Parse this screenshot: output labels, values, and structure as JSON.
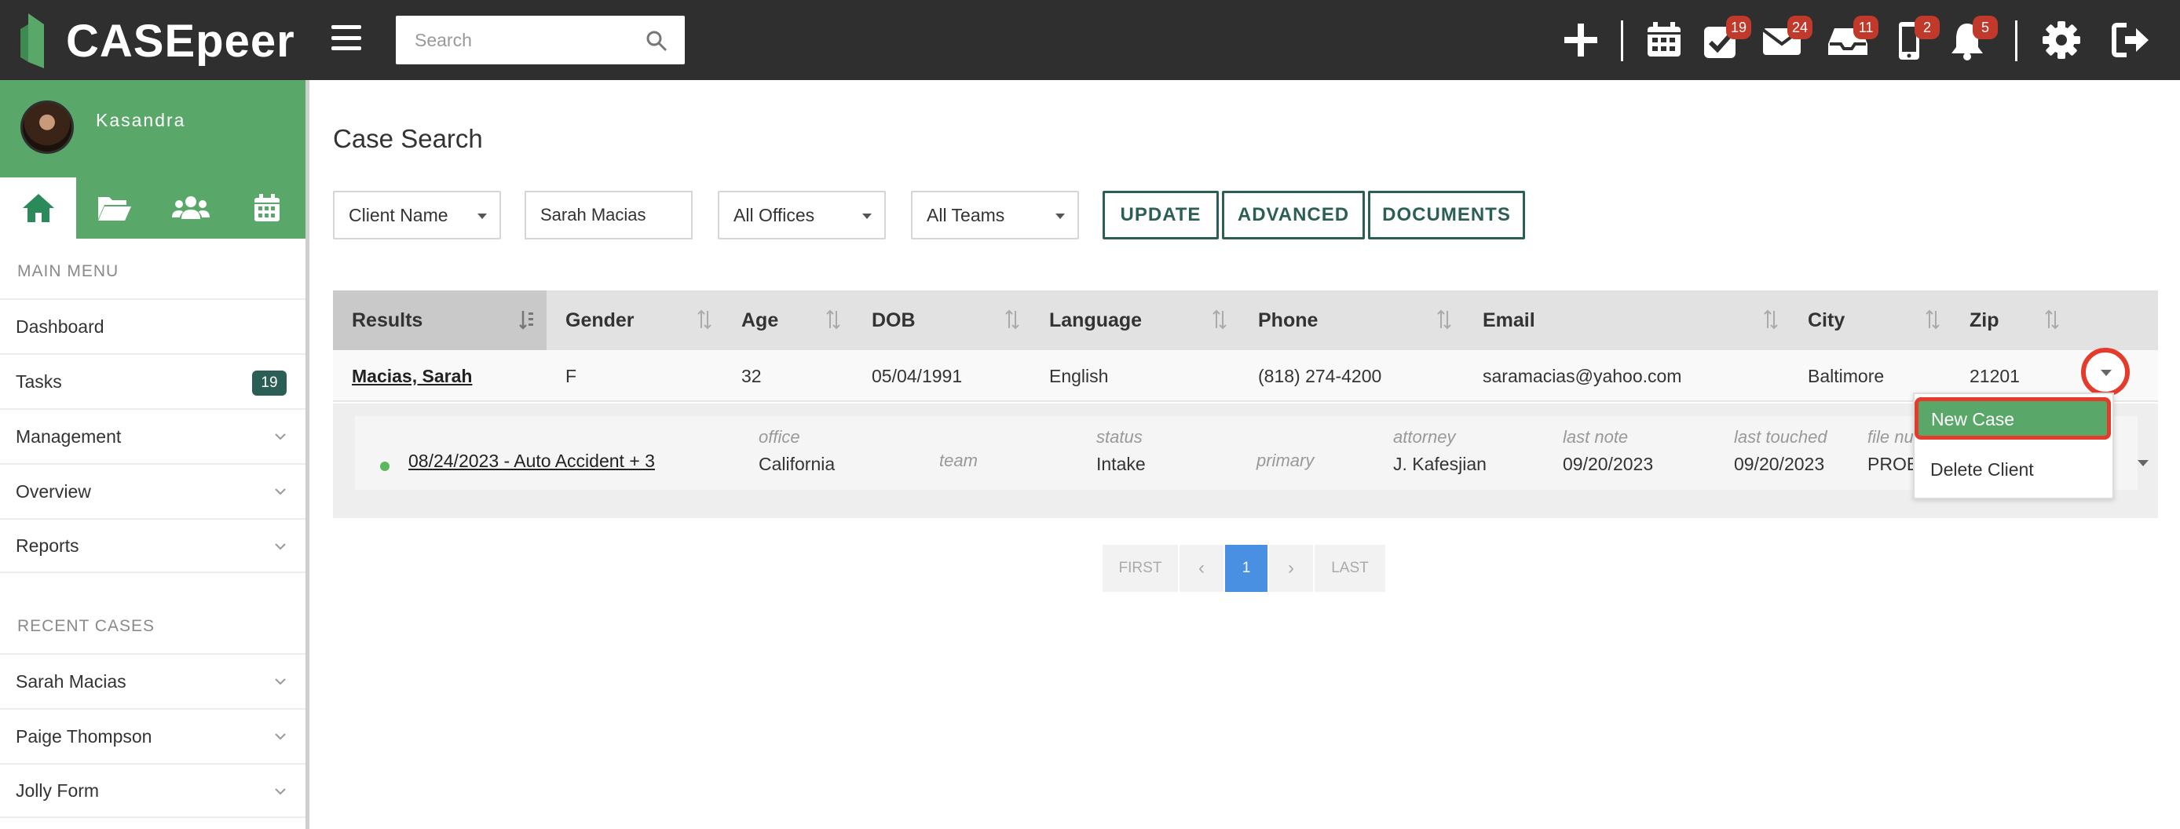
{
  "app": {
    "brand": "CASEpeer",
    "search_placeholder": "Search"
  },
  "topbar": {
    "badges": {
      "tasks": "19",
      "mail": "24",
      "inbox": "11",
      "phone": "2",
      "notifications": "5"
    }
  },
  "sidebar": {
    "user_name": "Kasandra",
    "main_menu_label": "MAIN MENU",
    "items": [
      {
        "label": "Dashboard"
      },
      {
        "label": "Tasks",
        "count": "19"
      },
      {
        "label": "Management"
      },
      {
        "label": "Overview"
      },
      {
        "label": "Reports"
      }
    ],
    "recent_label": "RECENT CASES",
    "recent": [
      {
        "label": "Sarah Macias"
      },
      {
        "label": "Paige Thompson"
      },
      {
        "label": "Jolly Form"
      }
    ]
  },
  "page": {
    "title": "Case Search"
  },
  "filters": {
    "field_select": "Client Name",
    "query_value": "Sarah Macias",
    "office_select": "All Offices",
    "team_select": "All Teams",
    "update_label": "UPDATE",
    "advanced_label": "ADVANCED",
    "documents_label": "DOCUMENTS"
  },
  "table": {
    "headers": [
      "Results",
      "Gender",
      "Age",
      "DOB",
      "Language",
      "Phone",
      "Email",
      "City",
      "Zip"
    ],
    "row": {
      "name": "Macias, Sarah",
      "gender": "F",
      "age": "32",
      "dob": "05/04/1991",
      "language": "English",
      "phone": "(818) 274-4200",
      "email": "saramacias@yahoo.com",
      "city": "Baltimore",
      "zip": "21201"
    },
    "case": {
      "link": "08/24/2023 - Auto Accident + 3",
      "office_label": "office",
      "office_value": "California",
      "team_label": "team",
      "status_label": "status",
      "status_value": "Intake",
      "primary_label": "primary",
      "attorney_label": "attorney",
      "attorney_value": "J. Kafesjian",
      "last_note_label": "last note",
      "last_note_value": "09/20/2023",
      "last_touched_label": "last touched",
      "last_touched_value": "09/20/2023",
      "file_label": "file nu",
      "file_value": "PROB"
    }
  },
  "dropdown": {
    "new_case": "New Case",
    "delete_client": "Delete Client"
  },
  "pagination": {
    "first": "FIRST",
    "prev": "‹",
    "current": "1",
    "next": "›",
    "last": "LAST"
  },
  "colors": {
    "topbar": "#2f2f2f",
    "brand_green": "#59a86a",
    "dark_teal": "#2b5f56",
    "badge_red": "#c0392b",
    "highlight_red": "#e53b2c",
    "pager_blue": "#4a90e2"
  }
}
